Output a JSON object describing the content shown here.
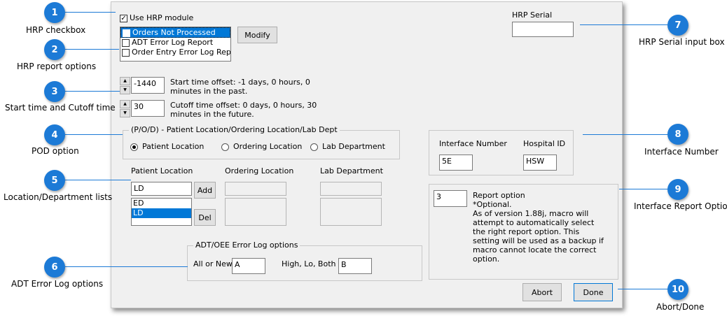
{
  "callouts": [
    {
      "num": "1",
      "label": "HRP checkbox"
    },
    {
      "num": "2",
      "label": "HRP report options"
    },
    {
      "num": "3",
      "label": "Start time and Cutoff time"
    },
    {
      "num": "4",
      "label": "POD option"
    },
    {
      "num": "5",
      "label": "Location/Department lists"
    },
    {
      "num": "6",
      "label": "ADT Error Log options"
    },
    {
      "num": "7",
      "label": "HRP Serial input box"
    },
    {
      "num": "8",
      "label": "Interface Number"
    },
    {
      "num": "9",
      "label": "Interface Report Option"
    },
    {
      "num": "10",
      "label": "Abort/Done"
    }
  ],
  "hrp": {
    "use_label": "Use HRP module",
    "use_checked": true,
    "reports": [
      {
        "label": "Orders Not Processed",
        "checked": true,
        "selected": true
      },
      {
        "label": "ADT Error Log Report",
        "checked": false,
        "selected": false
      },
      {
        "label": "Order Entry Error Log Report",
        "checked": false,
        "selected": false
      }
    ],
    "modify_label": "Modify",
    "serial_label": "HRP Serial",
    "serial_value": ""
  },
  "times": {
    "start_value": "-1440",
    "start_text": "Start time offset: -1 days, 0 hours, 0 minutes  in the past.",
    "cutoff_value": "30",
    "cutoff_text": "Cutoff time offset: 0 days, 0 hours, 30 minutes  in the future."
  },
  "pod": {
    "group_label": "(P/O/D) - Patient Location/Ordering Location/Lab Dept",
    "options": [
      "Patient Location",
      "Ordering Location",
      "Lab Department"
    ],
    "selected": "Patient Location"
  },
  "lists": {
    "patient_label": "Patient Location",
    "patient_input": "LD",
    "patient_items": [
      "ED",
      "LD"
    ],
    "patient_selected": "LD",
    "add_label": "Add",
    "del_label": "Del",
    "ordering_label": "Ordering Location",
    "lab_label": "Lab Department"
  },
  "adt": {
    "group_label": "ADT/OEE Error Log options",
    "all_new_label": "All or New",
    "all_new_value": "A",
    "hlb_label": "High, Lo, Both",
    "hlb_value": "B"
  },
  "interface": {
    "number_label": "Interface Number",
    "number_value": "5E",
    "hospital_label": "Hospital ID",
    "hospital_value": "HSW"
  },
  "report_option": {
    "value": "3",
    "title": "Report option",
    "text": "*Optional.\nAs of version 1.88j, macro will attempt to automatically select the right report option.  This setting will be used as a backup if macro cannot locate the correct option."
  },
  "buttons": {
    "abort_label": "Abort",
    "done_label": "Done"
  },
  "colors": {
    "callout": "#1c7ad6",
    "selection": "#0078d7",
    "dialog_bg": "#f0f0f0"
  }
}
